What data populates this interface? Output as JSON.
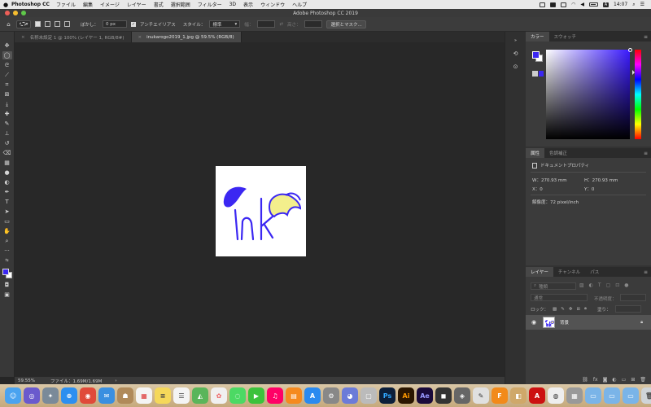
{
  "menubar": {
    "app_name": "Photoshop CC",
    "items": [
      "ファイル",
      "編集",
      "イメージ",
      "レイヤー",
      "書式",
      "選択範囲",
      "フィルター",
      "3D",
      "表示",
      "ウィンドウ",
      "ヘルプ"
    ],
    "input_source": "A",
    "clock": "14:07"
  },
  "window": {
    "title": "Adobe Photoshop CC 2019"
  },
  "options_bar": {
    "feather_label": "ぼかし：",
    "feather_value": "0 px",
    "antialias_label": "アンチエイリアス",
    "style_label": "スタイル：",
    "style_value": "標準",
    "width_label": "幅：",
    "height_label": "高さ：",
    "select_mask_button": "選択とマスク..."
  },
  "doc_tabs": [
    {
      "label": "名称未設定 1 @ 100% (レイヤー 1, RGB/8#)",
      "active": false
    },
    {
      "label": "inukarogo2019_1.jpg @ 59.5% (RGB/8)",
      "active": true
    }
  ],
  "status_bar": {
    "zoom": "59.55%",
    "file_info": "ファイル：1.69M/1.69M"
  },
  "color_panel": {
    "tabs": [
      "カラー",
      "スウォッチ"
    ],
    "foreground_color": "#3b27f2",
    "background_color": "#ffffff"
  },
  "properties_panel": {
    "tabs": [
      "属性",
      "色調補正"
    ],
    "heading": "ドキュメントプロパティ",
    "width": "W：270.93 mm",
    "height": "H：270.93 mm",
    "x": "X：0",
    "y": "Y：0",
    "resolution": "解像度：72 pixel/inch"
  },
  "layers_panel": {
    "tabs": [
      "レイヤー",
      "チャンネル",
      "パス"
    ],
    "filter_label": "種類",
    "blend_mode": "通常",
    "opacity_label": "不透明度：",
    "lock_label": "ロック：",
    "fill_label": "塗り：",
    "layers": [
      {
        "name": "背景",
        "locked": true,
        "visible": true
      }
    ]
  },
  "artwork": {
    "stroke_color": "#3b27f2",
    "fill_color": "#f3ef8c"
  }
}
